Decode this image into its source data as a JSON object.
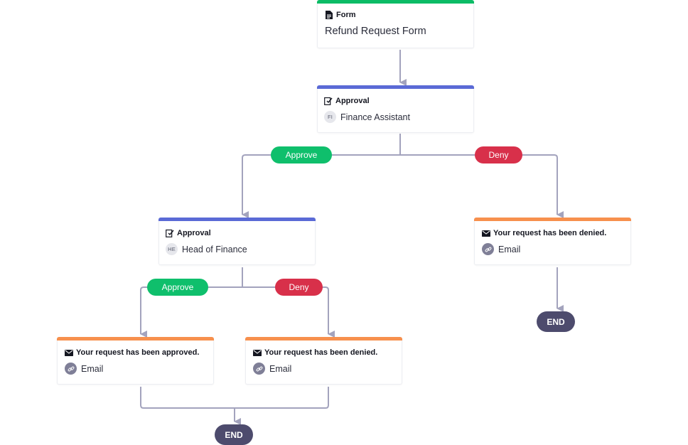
{
  "colors": {
    "form_accent": "#0cbc66",
    "approval_accent": "#5a6ad6",
    "email_accent": "#f7904d",
    "approve_pill": "#0fbf6c",
    "deny_pill": "#d8304a",
    "end_node": "#4d4b6d",
    "connector": "#a3a3bd"
  },
  "nodes": {
    "form": {
      "type_label": "Form",
      "icon": "form-document-icon",
      "title": "Refund Request Form"
    },
    "approval_1": {
      "type_label": "Approval",
      "icon": "approval-icon",
      "assignee_initials": "FI",
      "assignee": "Finance Assistant"
    },
    "approval_2": {
      "type_label": "Approval",
      "icon": "approval-icon",
      "assignee_initials": "HE",
      "assignee": "Head of Finance"
    },
    "email_denied_1": {
      "title": "Your request has been denied.",
      "icon": "envelope-icon",
      "channel_icon": "link-icon",
      "channel": "Email"
    },
    "email_approved": {
      "title": "Your request has been approved.",
      "icon": "envelope-icon",
      "channel_icon": "link-icon",
      "channel": "Email"
    },
    "email_denied_2": {
      "title": "Your request has been denied.",
      "icon": "envelope-icon",
      "channel_icon": "link-icon",
      "channel": "Email"
    }
  },
  "branches": {
    "level1": {
      "approve": "Approve",
      "deny": "Deny"
    },
    "level2": {
      "approve": "Approve",
      "deny": "Deny"
    }
  },
  "ends": {
    "end_1": "END",
    "end_2": "END"
  }
}
